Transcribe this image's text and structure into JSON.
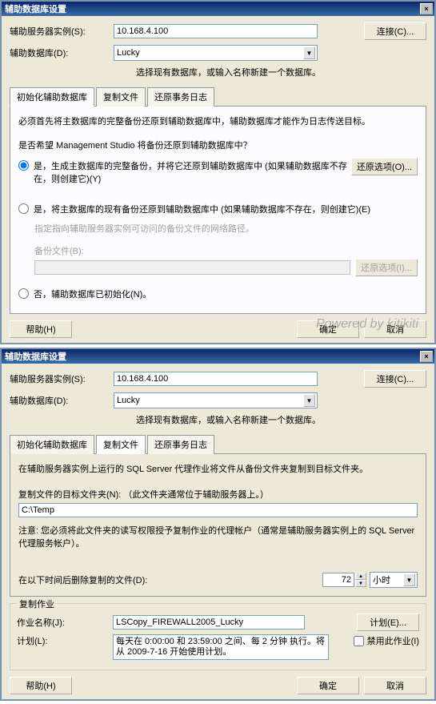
{
  "dialog1": {
    "title": "辅助数据库设置",
    "close_x": "×",
    "server_label": "辅助服务器实例(S):",
    "server_value": "10.168.4.100",
    "connect_btn": "连接(C)...",
    "db_label": "辅助数据库(D):",
    "db_value": "Lucky",
    "db_hint": "选择现有数据库，或输入名称新建一个数据库。",
    "tabs": {
      "t1": "初始化辅助数据库",
      "t2": "复制文件",
      "t3": "还原事务日志"
    },
    "pane": {
      "desc": "必须首先将主数据库的完整备份还原到辅助数据库中，辅助数据库才能作为日志传送目标。",
      "q": "是否希望 Management Studio 将备份还原到辅助数据库中？",
      "opt1": "是，生成主数据库的完整备份，并将它还原到辅助数据库中 (如果辅助数据库不存在，则创建它)(Y)",
      "restore_btn": "还原选项(O)...",
      "opt2": "是，将主数据库的现有备份还原到辅助数据库中 (如果辅助数据库不存在，则创建它)(E)",
      "sub_hint": "指定指向辅助服务器实例可访问的备份文件的网络路径。",
      "backup_label": "备份文件(B):",
      "restore_btn2": "还原选项(I)...",
      "opt3": "否，辅助数据库已初始化(N)。"
    },
    "help_btn": "帮助(H)",
    "ok_btn": "确定",
    "cancel_btn": "取消",
    "watermark": "Powered by kitikiti"
  },
  "dialog2": {
    "title": "辅助数据库设置",
    "close_x": "×",
    "server_label": "辅助服务器实例(S):",
    "server_value": "10.168.4.100",
    "connect_btn": "连接(C)...",
    "db_label": "辅助数据库(D):",
    "db_value": "Lucky",
    "db_hint": "选择现有数据库，或输入名称新建一个数据库。",
    "tabs": {
      "t1": "初始化辅助数据库",
      "t2": "复制文件",
      "t3": "还原事务日志"
    },
    "pane": {
      "desc": "在辅助服务器实例上运行的 SQL Server 代理作业将文件从备份文件夹复制到目标文件夹。",
      "folder_label": "复制文件的目标文件夹(N): （此文件夹通常位于辅助服务器上。）",
      "folder_value": "C:\\Temp",
      "note": "注意: 您必须将此文件夹的读写权限授予复制作业的代理帐户（通常是辅助服务器实例上的 SQL Server 代理服务帐户）。",
      "delete_label": "在以下时间后删除复制的文件(D):",
      "delete_value": "72",
      "delete_unit": "小时",
      "group_title": "复制作业",
      "job_name_label": "作业名称(J):",
      "job_name_value": "LSCopy_FIREWALL2005_Lucky",
      "schedule_btn": "计划(E)...",
      "schedule_label": "计划(L):",
      "schedule_value": "每天在 0:00:00 和 23:59:00 之间、每 2 分钟 执行。将从 2009-7-16 开始使用计划。",
      "disable_chk": "禁用此作业(I)"
    },
    "help_btn": "帮助(H)",
    "ok_btn": "确定",
    "cancel_btn": "取消"
  }
}
